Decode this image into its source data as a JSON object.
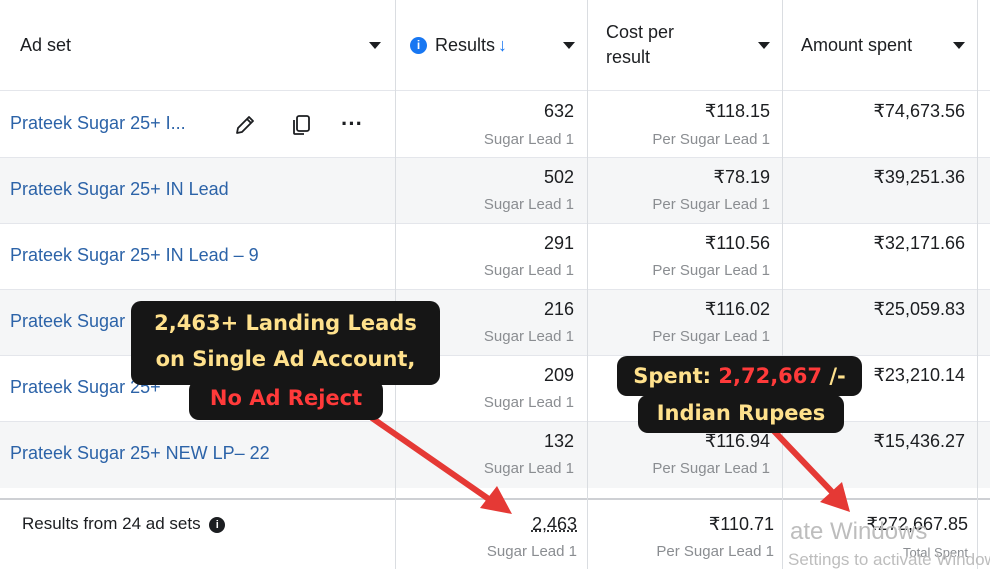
{
  "columns": {
    "ad_set": "Ad set",
    "results": "Results",
    "results_sort": "↓",
    "info_icon": "i",
    "cost_line1": "Cost per",
    "cost_line2": "result",
    "amount": "Amount spent"
  },
  "rows": [
    {
      "name": "Prateek Sugar 25+ I...",
      "results": "632",
      "results_sub": "Sugar Lead 1",
      "cost": "₹118.15",
      "cost_sub": "Per Sugar Lead 1",
      "amount": "₹74,673.56"
    },
    {
      "name": "Prateek Sugar 25+ IN Lead",
      "results": "502",
      "results_sub": "Sugar Lead 1",
      "cost": "₹78.19",
      "cost_sub": "Per Sugar Lead 1",
      "amount": "₹39,251.36"
    },
    {
      "name": "Prateek Sugar 25+ IN Lead – 9",
      "results": "291",
      "results_sub": "Sugar Lead 1",
      "cost": "₹110.56",
      "cost_sub": "Per Sugar Lead 1",
      "amount": "₹32,171.66"
    },
    {
      "name": "Prateek Sugar",
      "results": "216",
      "results_sub": "Sugar Lead 1",
      "cost": "₹116.02",
      "cost_sub": "Per Sugar Lead 1",
      "amount": "₹25,059.83"
    },
    {
      "name": "Prateek Sugar 25+",
      "results": "209",
      "results_sub": "Sugar Lead 1",
      "cost": "",
      "cost_sub": "",
      "amount": "₹23,210.14"
    },
    {
      "name": "Prateek Sugar 25+ NEW LP– 22",
      "results": "132",
      "results_sub": "Sugar Lead 1",
      "cost": "₹116.94",
      "cost_sub": "Per Sugar Lead 1",
      "amount": "₹15,436.27"
    }
  ],
  "row_icons": [
    "pencil-icon",
    "duplicate-icon",
    "more-icon"
  ],
  "more_dots": "···",
  "footer": {
    "label": "Results from 24 ad sets",
    "info_icon": "i",
    "results": "2,463",
    "results_sub": "Sugar Lead 1",
    "cost": "₹110.71",
    "cost_sub": "Per Sugar Lead 1",
    "amount": "₹272,667.85",
    "amount_sub": "Total Spent"
  },
  "callout_left": {
    "line1": "2,463+ Landing Leads",
    "line2": "on Single Ad Account,",
    "line3": "No Ad Reject"
  },
  "callout_right": {
    "line1_prefix": "Spent: ",
    "line1_amount": "2,72,667",
    "line1_suffix": " /-",
    "line2": "Indian Rupees"
  },
  "watermark": {
    "line1": "ate Windows",
    "line2": "Settings to activate Windows"
  },
  "colors": {
    "link": "#2c63a8",
    "info": "#1877f2",
    "callout_bg": "#161616",
    "callout_text": "#ffe18c",
    "callout_red": "#ff3a3a",
    "arrow": "#e53935"
  }
}
